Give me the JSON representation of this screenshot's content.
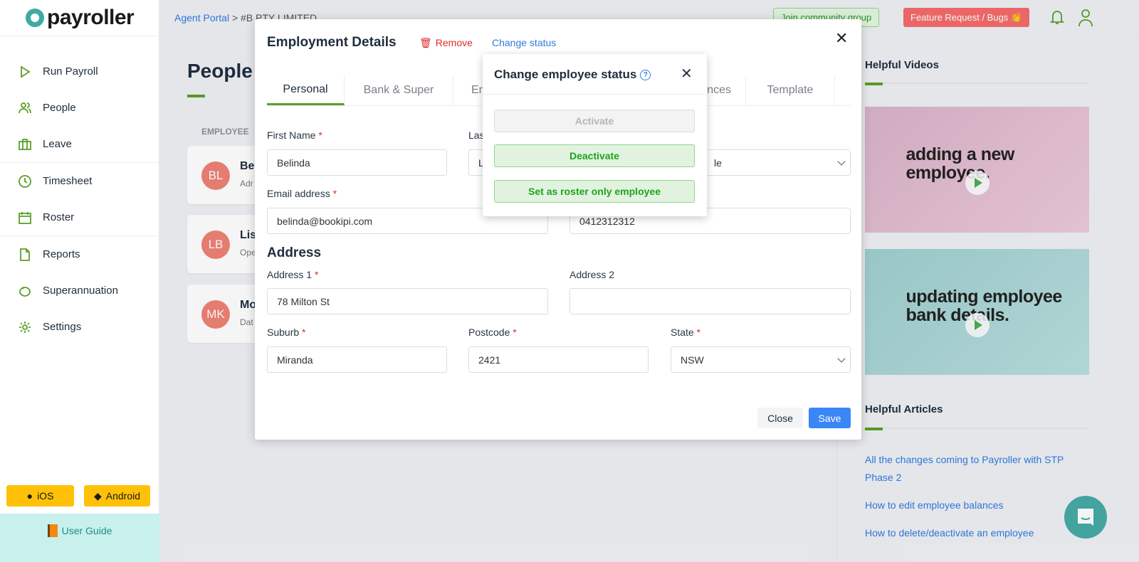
{
  "brand": {
    "name": "payroller",
    "accent": "#5aa028",
    "teal": "#3fa9a5"
  },
  "sidebar": {
    "items": [
      {
        "label": "Run Payroll",
        "icon": "play-icon"
      },
      {
        "label": "People",
        "icon": "people-icon"
      },
      {
        "label": "Leave",
        "icon": "briefcase-icon"
      },
      {
        "label": "Timesheet",
        "icon": "clock-icon"
      },
      {
        "label": "Roster",
        "icon": "calendar-icon"
      },
      {
        "label": "Reports",
        "icon": "file-icon"
      },
      {
        "label": "Superannuation",
        "icon": "piggy-bank-icon"
      },
      {
        "label": "Settings",
        "icon": "gear-icon"
      }
    ],
    "ios_label": "iOS",
    "android_label": "Android",
    "user_guide_label": "User Guide"
  },
  "breadcrumb": {
    "root": "Agent Portal",
    "current": "#B PTY LIMITED"
  },
  "topbar": {
    "community_label": "Join community group",
    "feature_label": "Feature Request / Bugs 👏"
  },
  "page": {
    "title": "People",
    "column_header": "EMPLOYEE",
    "employees": [
      {
        "initials": "BL",
        "name": "Be",
        "role": "Adr"
      },
      {
        "initials": "LB",
        "name": "Lis",
        "role": "Ope"
      },
      {
        "initials": "MK",
        "name": "Mo",
        "role": "Dat"
      }
    ]
  },
  "modal": {
    "title": "Employment Details",
    "remove_label": "Remove",
    "change_status_label": "Change status",
    "tabs": [
      "Personal",
      "Bank & Super",
      "Em",
      "nces",
      "Template"
    ],
    "fields": {
      "first_name_label": "First Name",
      "first_name": "Belinda",
      "last_name_label": "Las",
      "last_name": "L",
      "gender_value": "le",
      "email_label": "Email address",
      "email": "belinda@bookipi.com",
      "phone": "0412312312",
      "address_heading": "Address",
      "address1_label": "Address 1",
      "address1": "78 Milton St",
      "address2_label": "Address 2",
      "address2": "",
      "suburb_label": "Suburb",
      "suburb": "Miranda",
      "postcode_label": "Postcode",
      "postcode": "2421",
      "state_label": "State",
      "state": "NSW"
    },
    "close_label": "Close",
    "save_label": "Save"
  },
  "popover": {
    "title": "Change employee status",
    "activate_label": "Activate",
    "deactivate_label": "Deactivate",
    "roster_label": "Set as roster only employee"
  },
  "right": {
    "videos_heading": "Helpful Videos",
    "videos": [
      "adding a new employee.",
      "updating employee bank details."
    ],
    "articles_heading": "Helpful Articles",
    "articles": [
      "All the changes coming to Payroller with STP Phase 2",
      "How to edit employee balances",
      "How to delete/deactivate an employee"
    ]
  }
}
